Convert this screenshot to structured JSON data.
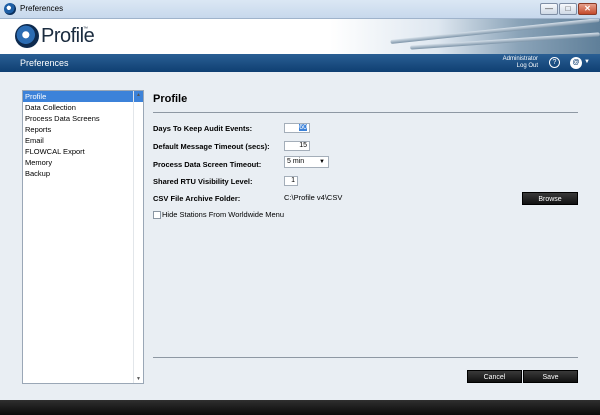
{
  "window": {
    "title": "Preferences",
    "min_label": "—",
    "max_label": "□",
    "close_label": "✕"
  },
  "brand": {
    "logo_text": "Profile",
    "tm": "™"
  },
  "header": {
    "title": "Preferences",
    "user_name": "Administrator",
    "logout": "Log Out",
    "help_symbol": "?",
    "menu_symbol": "@"
  },
  "sidebar": {
    "items": [
      {
        "label": "Profile",
        "selected": true
      },
      {
        "label": "Data Collection"
      },
      {
        "label": "Process Data Screens"
      },
      {
        "label": "Reports"
      },
      {
        "label": "Email"
      },
      {
        "label": "FLOWCAL Export"
      },
      {
        "label": "Memory"
      },
      {
        "label": "Backup"
      }
    ]
  },
  "main": {
    "title": "Profile",
    "fields": {
      "audit_days": {
        "label": "Days To Keep Audit Events:",
        "value": "60"
      },
      "msg_timeout": {
        "label": "Default Message Timeout (secs):",
        "value": "15"
      },
      "pds_timeout": {
        "label": "Process Data Screen Timeout:",
        "value": "5 min"
      },
      "rtu_level": {
        "label": "Shared RTU Visibility Level:",
        "value": "1"
      },
      "csv_folder": {
        "label": "CSV File Archive Folder:",
        "value": "C:\\Profile v4\\CSV"
      }
    },
    "browse_label": "Browse",
    "hide_stations_label": "Hide Stations From Worldwide Menu",
    "cancel_label": "Cancel",
    "save_label": "Save"
  },
  "colors": {
    "accent": "#3c82d9",
    "header": "#1a4d84",
    "button": "#1a1a1a"
  }
}
